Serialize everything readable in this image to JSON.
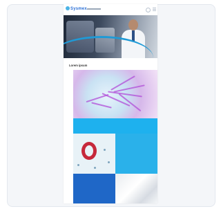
{
  "header": {
    "logo": "Sysmex",
    "icons": [
      "search-icon",
      "menu-icon"
    ]
  },
  "hero": {
    "title": "",
    "subtitle": ""
  },
  "section": {
    "title": "Lorem ipsum"
  },
  "tiles": [
    {
      "tag": "",
      "text": ""
    },
    {
      "tag": "",
      "text": ""
    },
    {
      "tag": "",
      "text": ""
    }
  ],
  "colors": {
    "accent": "#1eb1ee",
    "brand": "#2a6fd6",
    "dark_tile": "#1f67c7"
  }
}
